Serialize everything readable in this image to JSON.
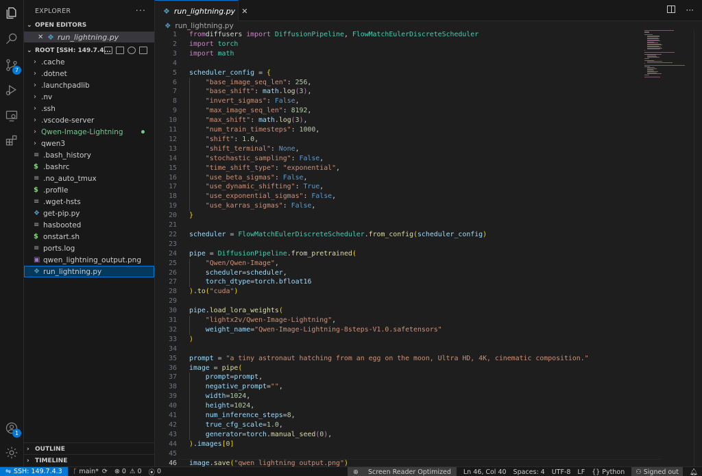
{
  "sidebar": {
    "title": "EXPLORER",
    "open_editors_label": "OPEN EDITORS",
    "open_editor_file": "run_lightning.py",
    "root_label": "ROOT [SSH: 149.7.4...",
    "items": [
      {
        "name": ".cache",
        "type": "folder"
      },
      {
        "name": ".dotnet",
        "type": "folder"
      },
      {
        "name": ".launchpadlib",
        "type": "folder"
      },
      {
        "name": ".nv",
        "type": "folder"
      },
      {
        "name": ".ssh",
        "type": "folder"
      },
      {
        "name": ".vscode-server",
        "type": "folder"
      },
      {
        "name": "Qwen-Image-Lightning",
        "type": "folder-git"
      },
      {
        "name": "qwen3",
        "type": "folder"
      },
      {
        "name": ".bash_history",
        "type": "lines"
      },
      {
        "name": ".bashrc",
        "type": "shell"
      },
      {
        "name": ".no_auto_tmux",
        "type": "lines"
      },
      {
        "name": ".profile",
        "type": "shell"
      },
      {
        "name": ".wget-hsts",
        "type": "lines"
      },
      {
        "name": "get-pip.py",
        "type": "python"
      },
      {
        "name": "hasbooted",
        "type": "lines"
      },
      {
        "name": "onstart.sh",
        "type": "shell"
      },
      {
        "name": "ports.log",
        "type": "lines"
      },
      {
        "name": "qwen_lightning_output.png",
        "type": "image"
      },
      {
        "name": "run_lightning.py",
        "type": "python-selected"
      }
    ],
    "outline_label": "OUTLINE",
    "timeline_label": "TIMELINE"
  },
  "activity": {
    "scm_badge": "7",
    "accounts_badge": "1"
  },
  "editor": {
    "tab_name": "run_lightning.py",
    "breadcrumb": "run_lightning.py",
    "current_line": 46,
    "lines": [
      [
        [
          "kw",
          "from"
        ],
        [
          "",
          "diffusers"
        ],
        [
          "kw",
          " import"
        ],
        [
          "cls",
          " DiffusionPipeline"
        ],
        [
          "",
          ", "
        ],
        [
          "cls",
          "FlowMatchEulerDiscreteScheduler"
        ]
      ],
      [
        [
          "kw",
          "import"
        ],
        [
          "cls",
          " torch"
        ]
      ],
      [
        [
          "kw",
          "import"
        ],
        [
          "cls",
          " math"
        ]
      ],
      [],
      [
        [
          "var",
          "scheduler_config"
        ],
        [
          "",
          " = "
        ],
        [
          "br1",
          "{"
        ]
      ],
      [
        [
          "",
          "    "
        ],
        [
          "str",
          "\"base_image_seq_len\""
        ],
        [
          "",
          ": "
        ],
        [
          "num",
          "256"
        ],
        [
          "",
          ","
        ]
      ],
      [
        [
          "",
          "    "
        ],
        [
          "str",
          "\"base_shift\""
        ],
        [
          "",
          ": "
        ],
        [
          "var",
          "math"
        ],
        [
          "",
          "."
        ],
        [
          "fn",
          "log"
        ],
        [
          "br2",
          "("
        ],
        [
          "num",
          "3"
        ],
        [
          "br2",
          ")"
        ],
        [
          "",
          ","
        ]
      ],
      [
        [
          "",
          "    "
        ],
        [
          "str",
          "\"invert_sigmas\""
        ],
        [
          "",
          ": "
        ],
        [
          "bool",
          "False"
        ],
        [
          "",
          ","
        ]
      ],
      [
        [
          "",
          "    "
        ],
        [
          "str",
          "\"max_image_seq_len\""
        ],
        [
          "",
          ": "
        ],
        [
          "num",
          "8192"
        ],
        [
          "",
          ","
        ]
      ],
      [
        [
          "",
          "    "
        ],
        [
          "str",
          "\"max_shift\""
        ],
        [
          "",
          ": "
        ],
        [
          "var",
          "math"
        ],
        [
          "",
          "."
        ],
        [
          "fn",
          "log"
        ],
        [
          "br2",
          "("
        ],
        [
          "num",
          "3"
        ],
        [
          "br2",
          ")"
        ],
        [
          "",
          ","
        ]
      ],
      [
        [
          "",
          "    "
        ],
        [
          "str",
          "\"num_train_timesteps\""
        ],
        [
          "",
          ": "
        ],
        [
          "num",
          "1000"
        ],
        [
          "",
          ","
        ]
      ],
      [
        [
          "",
          "    "
        ],
        [
          "str",
          "\"shift\""
        ],
        [
          "",
          ": "
        ],
        [
          "num",
          "1.0"
        ],
        [
          "",
          ","
        ]
      ],
      [
        [
          "",
          "    "
        ],
        [
          "str",
          "\"shift_terminal\""
        ],
        [
          "",
          ": "
        ],
        [
          "bool",
          "None"
        ],
        [
          "",
          ","
        ]
      ],
      [
        [
          "",
          "    "
        ],
        [
          "str",
          "\"stochastic_sampling\""
        ],
        [
          "",
          ": "
        ],
        [
          "bool",
          "False"
        ],
        [
          "",
          ","
        ]
      ],
      [
        [
          "",
          "    "
        ],
        [
          "str",
          "\"time_shift_type\""
        ],
        [
          "",
          ": "
        ],
        [
          "str",
          "\"exponential\""
        ],
        [
          "",
          ","
        ]
      ],
      [
        [
          "",
          "    "
        ],
        [
          "str",
          "\"use_beta_sigmas\""
        ],
        [
          "",
          ": "
        ],
        [
          "bool",
          "False"
        ],
        [
          "",
          ","
        ]
      ],
      [
        [
          "",
          "    "
        ],
        [
          "str",
          "\"use_dynamic_shifting\""
        ],
        [
          "",
          ": "
        ],
        [
          "bool",
          "True"
        ],
        [
          "",
          ","
        ]
      ],
      [
        [
          "",
          "    "
        ],
        [
          "str",
          "\"use_exponential_sigmas\""
        ],
        [
          "",
          ": "
        ],
        [
          "bool",
          "False"
        ],
        [
          "",
          ","
        ]
      ],
      [
        [
          "",
          "    "
        ],
        [
          "str",
          "\"use_karras_sigmas\""
        ],
        [
          "",
          ": "
        ],
        [
          "bool",
          "False"
        ],
        [
          "",
          ","
        ]
      ],
      [
        [
          "br1",
          "}"
        ]
      ],
      [],
      [
        [
          "var",
          "scheduler"
        ],
        [
          "",
          " = "
        ],
        [
          "cls",
          "FlowMatchEulerDiscreteScheduler"
        ],
        [
          "",
          "."
        ],
        [
          "fn",
          "from_config"
        ],
        [
          "br1",
          "("
        ],
        [
          "var",
          "scheduler_config"
        ],
        [
          "br1",
          ")"
        ]
      ],
      [],
      [
        [
          "var",
          "pipe"
        ],
        [
          "",
          " = "
        ],
        [
          "cls",
          "DiffusionPipeline"
        ],
        [
          "",
          "."
        ],
        [
          "fn",
          "from_pretrained"
        ],
        [
          "br1",
          "("
        ]
      ],
      [
        [
          "",
          "    "
        ],
        [
          "str",
          "\"Qwen/Qwen-Image\""
        ],
        [
          "",
          ","
        ]
      ],
      [
        [
          "",
          "    "
        ],
        [
          "var",
          "scheduler"
        ],
        [
          "",
          "="
        ],
        [
          "var",
          "scheduler"
        ],
        [
          "",
          ","
        ]
      ],
      [
        [
          "",
          "    "
        ],
        [
          "var",
          "torch_dtype"
        ],
        [
          "",
          "="
        ],
        [
          "var",
          "torch"
        ],
        [
          "",
          "."
        ],
        [
          "var",
          "bfloat16"
        ]
      ],
      [
        [
          "br1",
          ")"
        ],
        [
          "",
          "."
        ],
        [
          "fn",
          "to"
        ],
        [
          "br1",
          "("
        ],
        [
          "str",
          "\"cuda\""
        ],
        [
          "br1",
          ")"
        ]
      ],
      [],
      [
        [
          "var",
          "pipe"
        ],
        [
          "",
          "."
        ],
        [
          "fn",
          "load_lora_weights"
        ],
        [
          "br1",
          "("
        ]
      ],
      [
        [
          "",
          "    "
        ],
        [
          "str",
          "\"lightx2v/Qwen-Image-Lightning\""
        ],
        [
          "",
          ","
        ]
      ],
      [
        [
          "",
          "    "
        ],
        [
          "var",
          "weight_name"
        ],
        [
          "",
          "="
        ],
        [
          "str",
          "\"Qwen-Image-Lightning-8steps-V1.0.safetensors\""
        ]
      ],
      [
        [
          "br1",
          ")"
        ]
      ],
      [],
      [
        [
          "var",
          "prompt"
        ],
        [
          "",
          " = "
        ],
        [
          "str",
          "\"a tiny astronaut hatching from an egg on the moon, Ultra HD, 4K, cinematic composition.\""
        ]
      ],
      [
        [
          "var",
          "image"
        ],
        [
          "",
          " = "
        ],
        [
          "fn",
          "pipe"
        ],
        [
          "br1",
          "("
        ]
      ],
      [
        [
          "",
          "    "
        ],
        [
          "var",
          "prompt"
        ],
        [
          "",
          "="
        ],
        [
          "var",
          "prompt"
        ],
        [
          "",
          ","
        ]
      ],
      [
        [
          "",
          "    "
        ],
        [
          "var",
          "negative_prompt"
        ],
        [
          "",
          "="
        ],
        [
          "str",
          "\"\""
        ],
        [
          "",
          ","
        ]
      ],
      [
        [
          "",
          "    "
        ],
        [
          "var",
          "width"
        ],
        [
          "",
          "="
        ],
        [
          "num",
          "1024"
        ],
        [
          "",
          ","
        ]
      ],
      [
        [
          "",
          "    "
        ],
        [
          "var",
          "height"
        ],
        [
          "",
          "="
        ],
        [
          "num",
          "1024"
        ],
        [
          "",
          ","
        ]
      ],
      [
        [
          "",
          "    "
        ],
        [
          "var",
          "num_inference_steps"
        ],
        [
          "",
          "="
        ],
        [
          "num",
          "8"
        ],
        [
          "",
          ","
        ]
      ],
      [
        [
          "",
          "    "
        ],
        [
          "var",
          "true_cfg_scale"
        ],
        [
          "",
          "="
        ],
        [
          "num",
          "1.0"
        ],
        [
          "",
          ","
        ]
      ],
      [
        [
          "",
          "    "
        ],
        [
          "var",
          "generator"
        ],
        [
          "",
          "="
        ],
        [
          "var",
          "torch"
        ],
        [
          "",
          "."
        ],
        [
          "fn",
          "manual_seed"
        ],
        [
          "br2",
          "("
        ],
        [
          "num",
          "0"
        ],
        [
          "br2",
          ")"
        ],
        [
          "",
          ","
        ]
      ],
      [
        [
          "br1",
          ")"
        ],
        [
          "",
          "."
        ],
        [
          "var",
          "images"
        ],
        [
          "br1",
          "["
        ],
        [
          "num",
          "0"
        ],
        [
          "br1",
          "]"
        ]
      ],
      [],
      [
        [
          "var",
          "image"
        ],
        [
          "",
          "."
        ],
        [
          "fn",
          "save"
        ],
        [
          "br1",
          "("
        ],
        [
          "str",
          "\"qwen_lightning_output.png\""
        ],
        [
          "br1",
          ")"
        ]
      ]
    ]
  },
  "statusbar": {
    "remote": "SSH: 149.7.4.3",
    "branch": "main*",
    "errors": "0",
    "warnings": "0",
    "ports": "0",
    "screen_reader": "Screen Reader Optimized",
    "cursor": "Ln 46, Col 40",
    "spaces": "Spaces: 4",
    "encoding": "UTF-8",
    "eol": "LF",
    "language": "Python",
    "account": "Signed out"
  },
  "colors": {
    "accent": "#0078d4",
    "keyword": "#c586c0",
    "string": "#ce9178",
    "class": "#4ec9b0",
    "function": "#dcdcaa",
    "number": "#b5cea8",
    "constant": "#569cd6",
    "variable": "#9cdcfe"
  }
}
